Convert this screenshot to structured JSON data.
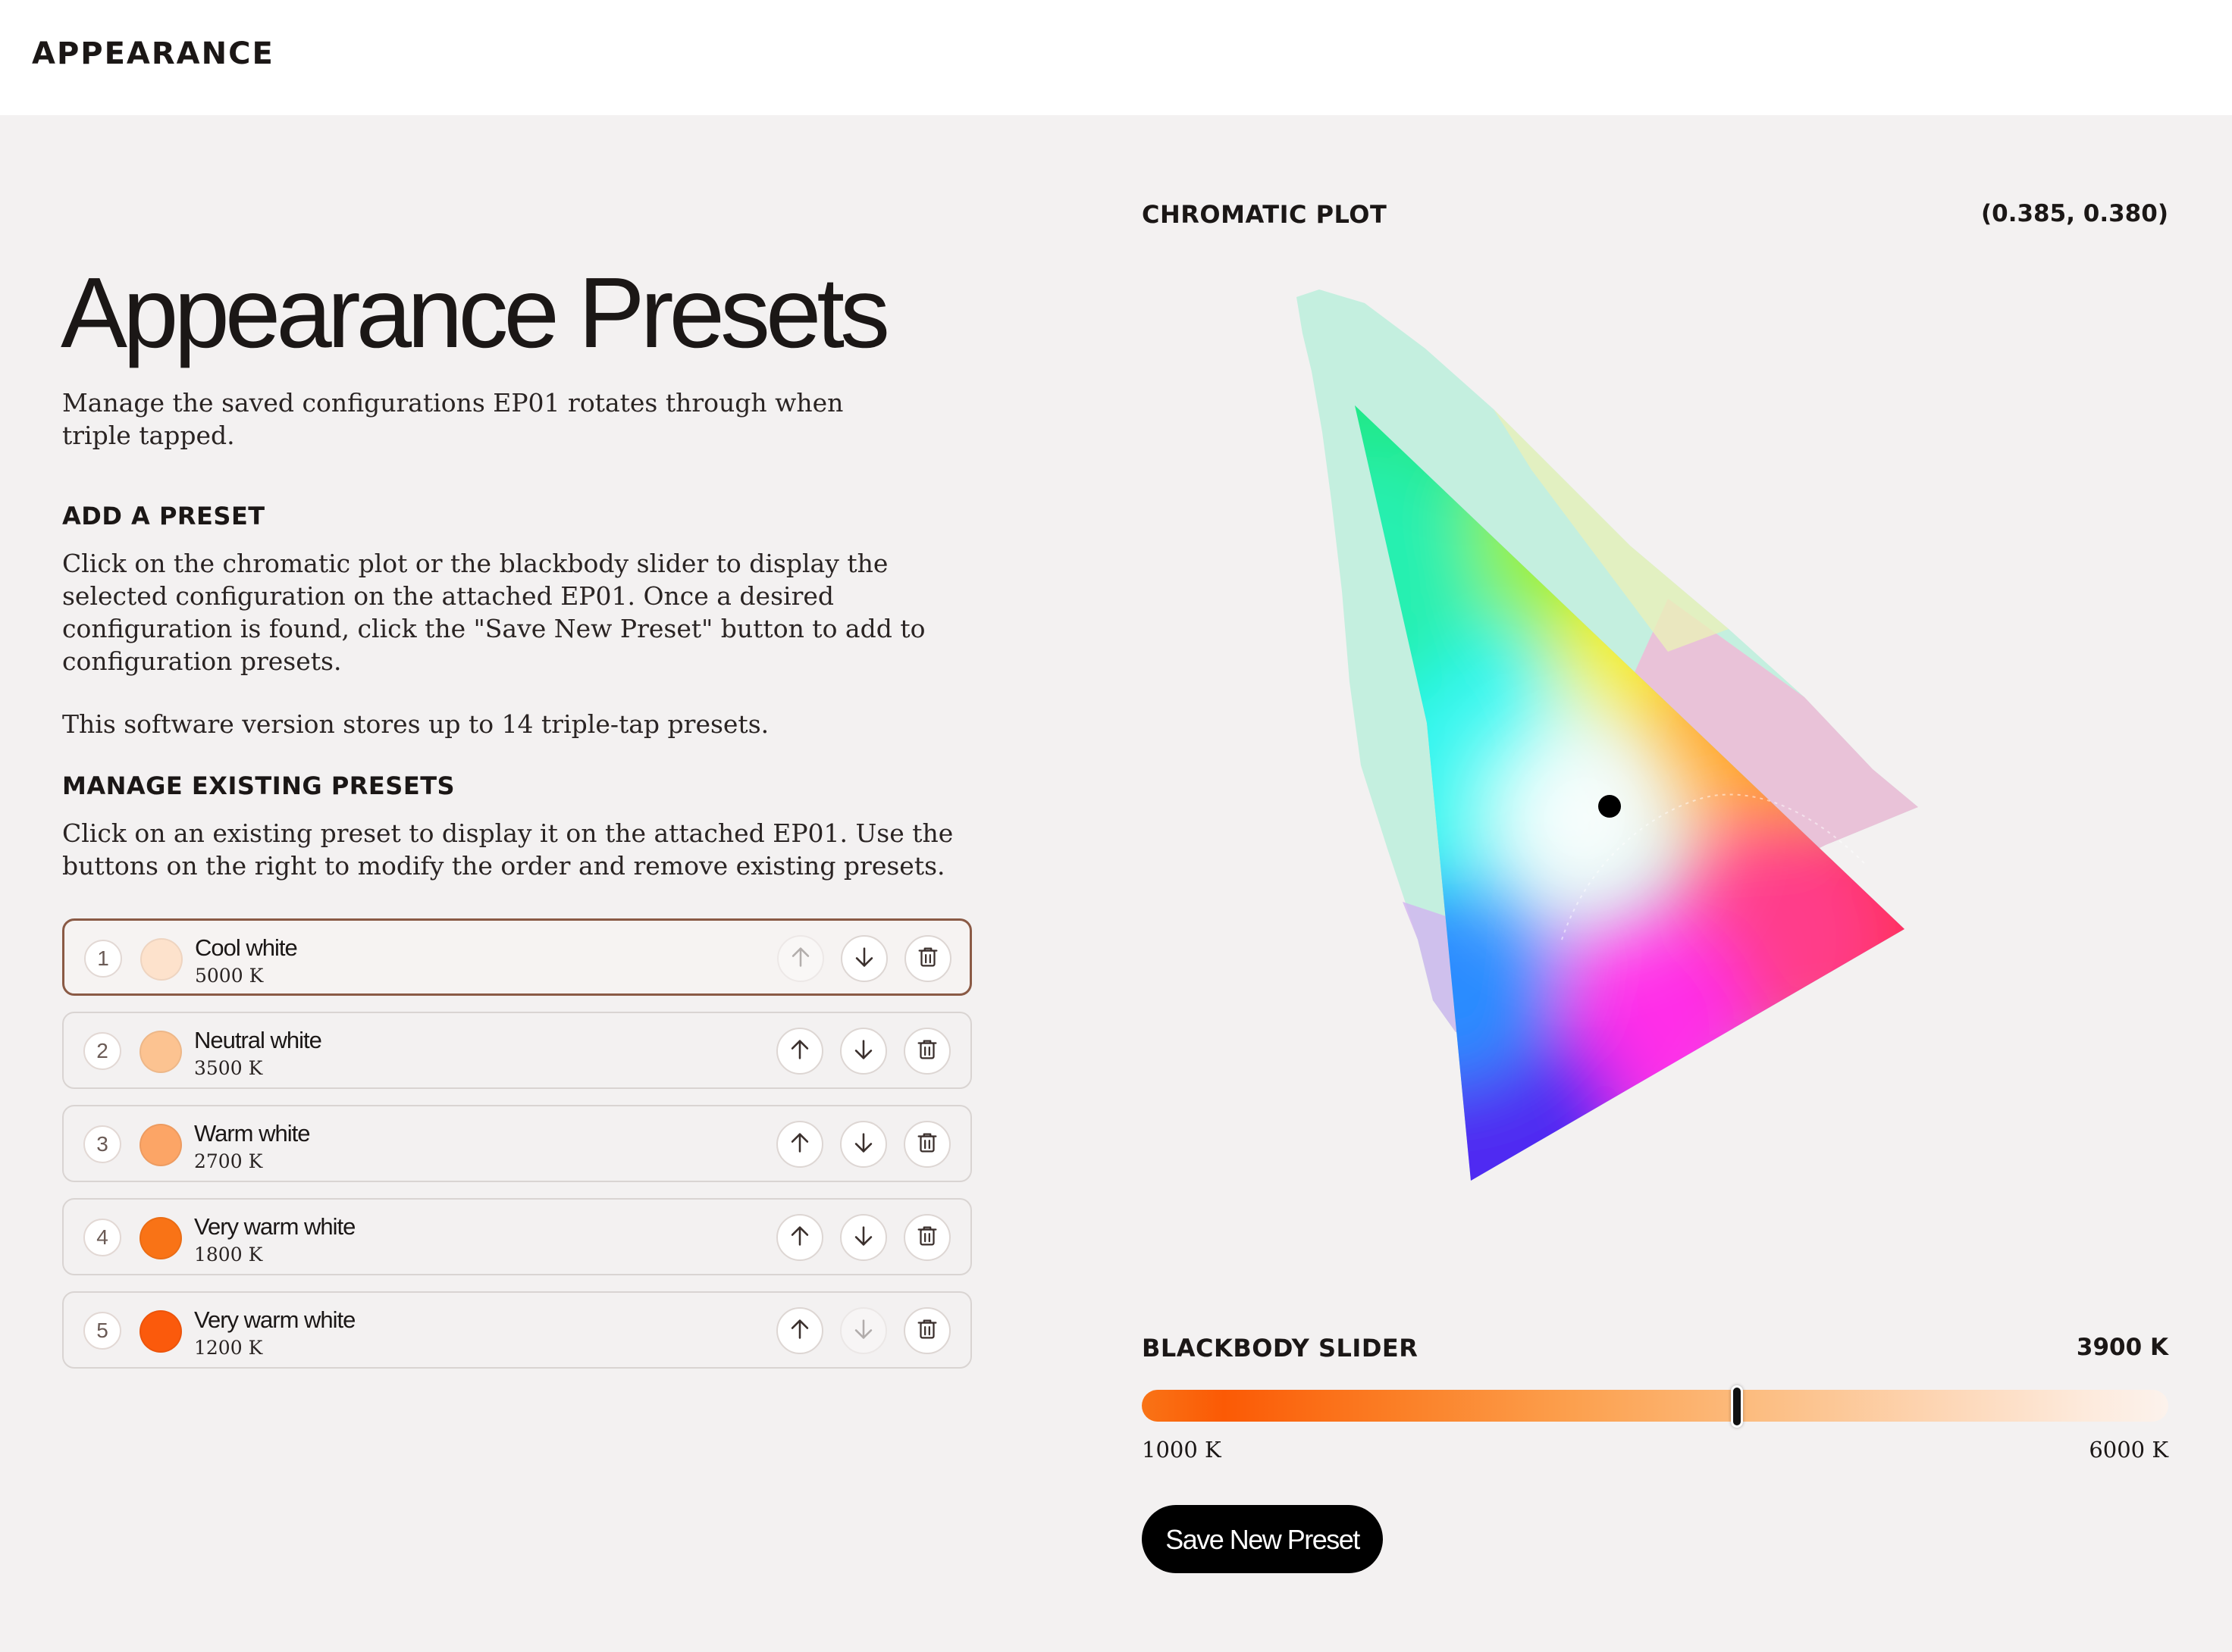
{
  "header": {
    "title": "APPEARANCE"
  },
  "main": {
    "title": "Appearance Presets",
    "intro": "Manage the saved configurations EP01 rotates through when triple tapped.",
    "add_heading": "ADD A PRESET",
    "add_text": "Click on the chromatic plot or the blackbody slider to display the selected configuration on the attached EP01. Once a desired configuration is found, click the \"Save New Preset\" button to add to configuration presets.",
    "capacity_text": "This software version stores up to 14 triple-tap presets.",
    "manage_heading": "MANAGE EXISTING PRESETS",
    "manage_text": "Click on an existing preset to display it on the attached EP01. Use the buttons on the right to modify the order and remove existing presets."
  },
  "presets": [
    {
      "index": "1",
      "name": "Cool white",
      "temp": "5000 K",
      "color": "#fde2cc",
      "selected": true,
      "up_enabled": false,
      "down_enabled": true
    },
    {
      "index": "2",
      "name": "Neutral white",
      "temp": "3500 K",
      "color": "#fcc391",
      "selected": false,
      "up_enabled": true,
      "down_enabled": true
    },
    {
      "index": "3",
      "name": "Warm white",
      "temp": "2700 K",
      "color": "#fca566",
      "selected": false,
      "up_enabled": true,
      "down_enabled": true
    },
    {
      "index": "4",
      "name": "Very warm white",
      "temp": "1800 K",
      "color": "#f97316",
      "selected": false,
      "up_enabled": true,
      "down_enabled": true
    },
    {
      "index": "5",
      "name": "Very warm white",
      "temp": "1200 K",
      "color": "#fb5a0c",
      "selected": false,
      "up_enabled": true,
      "down_enabled": false
    }
  ],
  "chromatic_plot": {
    "label": "CHROMATIC PLOT",
    "coordinate": "(0.385, 0.380)",
    "selected_xy": [
      0.385,
      0.38
    ]
  },
  "blackbody": {
    "label": "BLACKBODY SLIDER",
    "value": "3900 K",
    "value_k": 3900,
    "min_label": "1000 K",
    "max_label": "6000 K",
    "min_k": 1000,
    "max_k": 6000
  },
  "actions": {
    "save_label": "Save New Preset"
  },
  "icons": {
    "up": "arrow-up-icon",
    "down": "arrow-down-icon",
    "delete": "trash-icon"
  }
}
